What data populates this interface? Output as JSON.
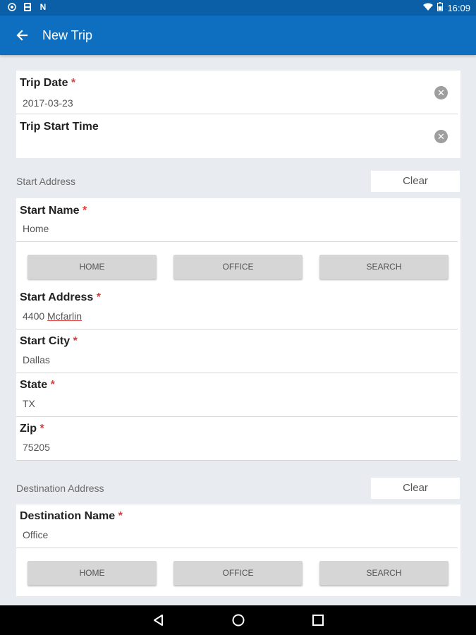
{
  "status_bar": {
    "time": "16:09"
  },
  "app_bar": {
    "title": "New Trip"
  },
  "trip": {
    "date_label": "Trip Date",
    "date_value": "2017-03-23",
    "start_time_label": "Trip Start Time",
    "start_time_value": ""
  },
  "required_mark": "*",
  "start_section": {
    "title": "Start Address",
    "clear_label": "Clear",
    "name_label": "Start Name",
    "name_value": "Home",
    "buttons": [
      "HOME",
      "OFFICE",
      "SEARCH"
    ],
    "address_label": "Start Address",
    "address_value_a": "4400",
    "address_value_b": "Mcfarlin",
    "city_label": "Start City",
    "city_value": "Dallas",
    "state_label": "State",
    "state_value": "TX",
    "zip_label": "Zip",
    "zip_value": "75205"
  },
  "destination_section": {
    "title": "Destination Address",
    "clear_label": "Clear",
    "name_label": "Destination Name",
    "name_value": "Office",
    "buttons": [
      "HOME",
      "OFFICE",
      "SEARCH"
    ]
  },
  "colors": {
    "app_bar": "#0e6fc1",
    "status_bar": "#0a5fa6",
    "required": "#e53935",
    "background": "#e8ebef"
  }
}
